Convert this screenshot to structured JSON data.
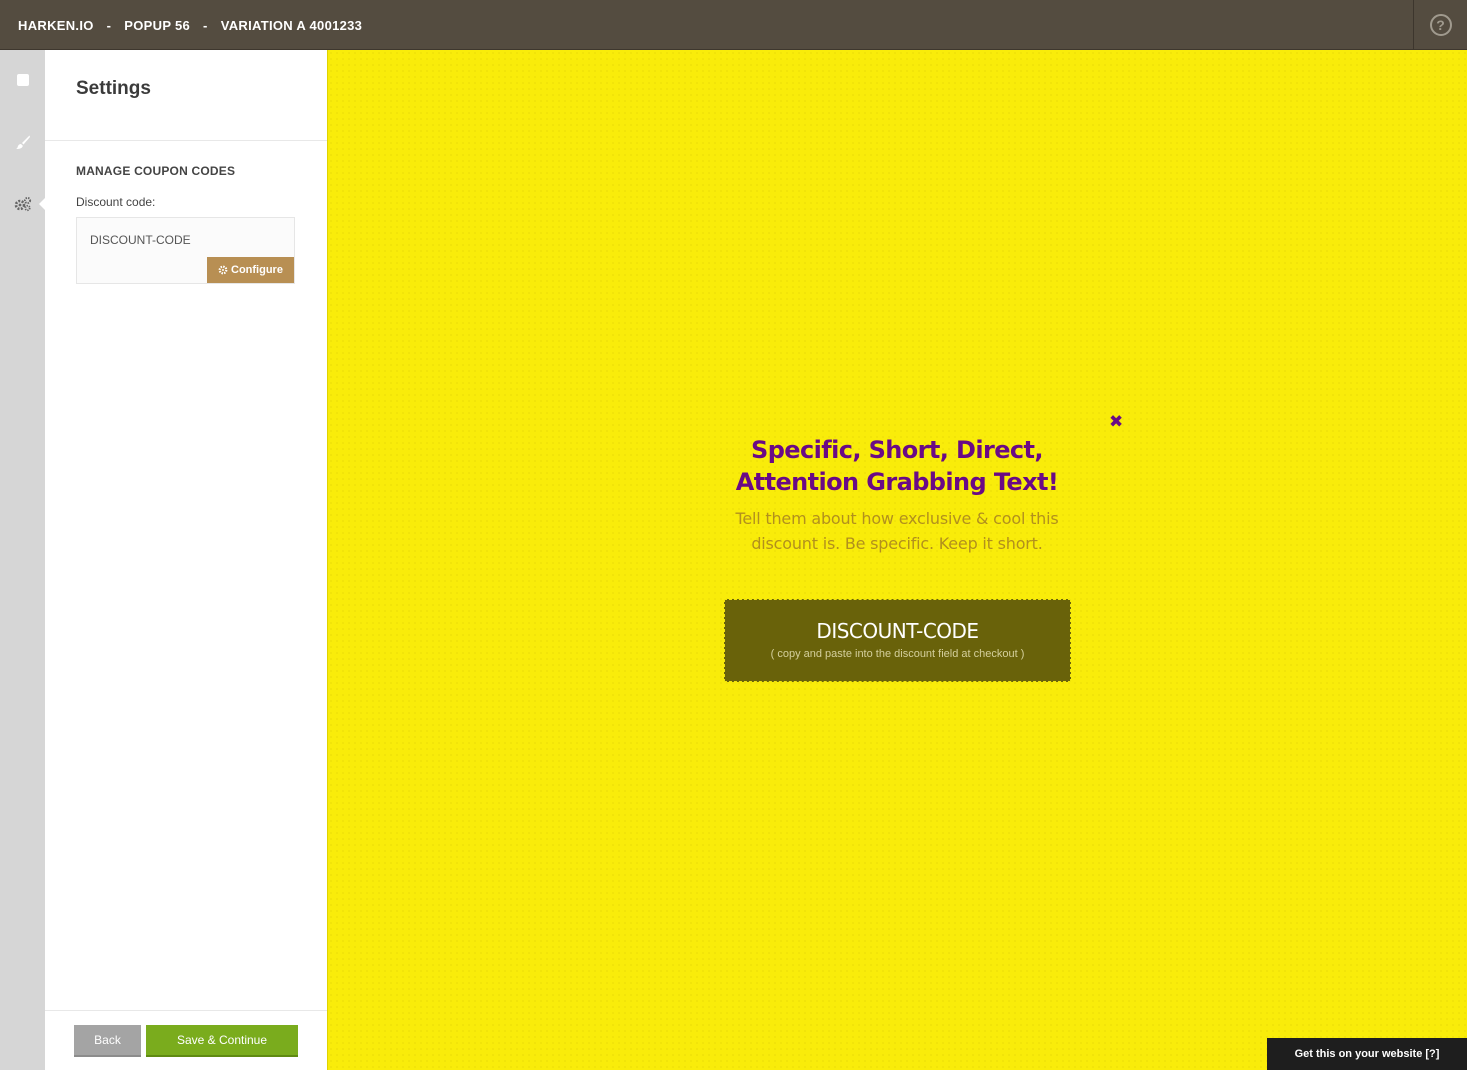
{
  "header": {
    "breadcrumb": [
      "HARKEN.IO",
      "POPUP 56",
      "VARIATION A 4001233"
    ],
    "separator": "-",
    "help_glyph": "?"
  },
  "rail": {
    "items": [
      {
        "icon": "square-icon",
        "active": false
      },
      {
        "icon": "brush-icon",
        "active": false
      },
      {
        "icon": "gears-icon",
        "active": true
      }
    ]
  },
  "settings": {
    "title": "Settings",
    "section_title": "MANAGE COUPON CODES",
    "discount_label": "Discount code:",
    "discount_value": "DISCOUNT-CODE",
    "configure_label": "Configure",
    "back_label": "Back",
    "save_label": "Save & Continue"
  },
  "popup": {
    "close_glyph": "✖",
    "headline": "Specific, Short, Direct, Attention Grabbing Text!",
    "subtext": "Tell them about how exclusive & cool this discount is. Be specific. Keep it short.",
    "coupon_code": "DISCOUNT-CODE",
    "coupon_hint": "( copy and paste into the discount field at checkout )"
  },
  "promo": {
    "label": "Get this on your website [?]"
  },
  "colors": {
    "topbar": "#544c40",
    "canvas": "#f9ec0a",
    "headline": "#6a0a86",
    "subtext": "#b2901d",
    "coupon_bg": "#69620a",
    "configure": "#b88f53",
    "save": "#7aac1d",
    "back": "#a4a4a4"
  }
}
